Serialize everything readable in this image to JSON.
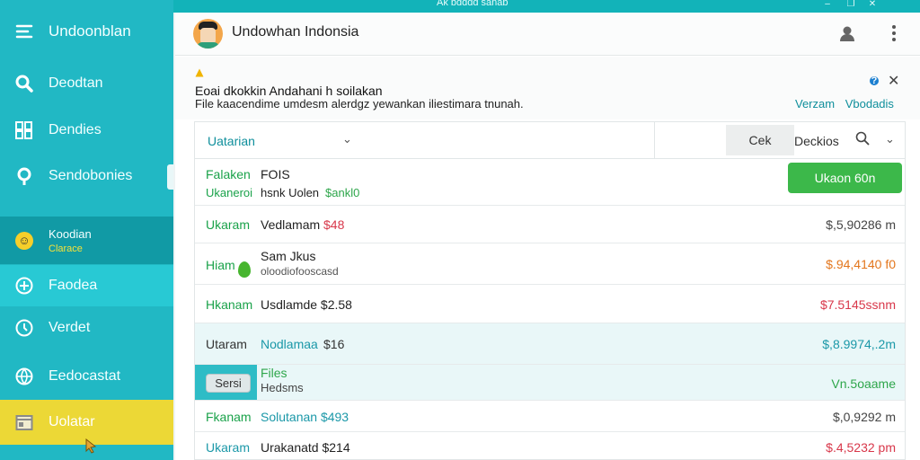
{
  "window": {
    "title": "Ak bdddd sanab",
    "minimize": "–",
    "restore": "❐",
    "close": "✕"
  },
  "sidebar": {
    "app_title": "Undoonblan",
    "items": [
      {
        "label": "Deodtan",
        "icon": "search-icon"
      },
      {
        "label": "Dendies",
        "icon": "grid-icon"
      },
      {
        "label": "Sendobonies",
        "icon": "key-icon"
      },
      {
        "label": "Koodian",
        "sub": "Clarace",
        "icon": "emoji-icon"
      },
      {
        "label": "Faodea",
        "icon": "target-icon"
      },
      {
        "label": "Verdet",
        "icon": "clock-icon"
      },
      {
        "label": "Eedocastat",
        "icon": "globe-icon"
      },
      {
        "label": "Uolatar",
        "icon": "calendar-icon"
      }
    ]
  },
  "header": {
    "title": "Undowhan Indonsia"
  },
  "notice": {
    "title": "Eoai dkokkin Andahani h soilakan",
    "desc": "File kaacendime umdesm alerdgz yewankan iliestimara tnunah.",
    "links": [
      "Verzam",
      "Vbodadis"
    ]
  },
  "toolbar": {
    "select": "Uatarian",
    "button": "Cek",
    "search_label": "Deckios"
  },
  "rows": [
    {
      "a": "Falaken",
      "b": "FOIS",
      "sub_a": "Ukaneroi",
      "sub_b": "hsnk Uolen",
      "sub_c": "$ankl0",
      "action": "Ukaon 60n"
    },
    {
      "a": "Ukaram",
      "b": "Vedlamam",
      "b_amt": "$48",
      "amount": "$,5,90286 m"
    },
    {
      "a": "Hiam",
      "b": "Sam Jkus",
      "b_sub": "oloodiofooscasd",
      "amount": "$.94,4140 f0"
    },
    {
      "a": "Hkanam",
      "b": "Usdlamde $2.58",
      "amount": "$7.5145ssnm"
    },
    {
      "a": "Utaram",
      "b": "Nodlamaa",
      "b_amt": "$16",
      "amount": "$,8.9974,.2m"
    },
    {
      "sel_button": "Sersi",
      "b": "Files",
      "b_sub": "Hedsms",
      "amount": "Vn.5oaame"
    },
    {
      "a": "Fkanam",
      "b": "Solutanan $493",
      "amount": "$,0,9292 m"
    },
    {
      "a": "Ukaram",
      "b": "Urakanatd $214",
      "amount": "$.4,5232 pm"
    }
  ]
}
